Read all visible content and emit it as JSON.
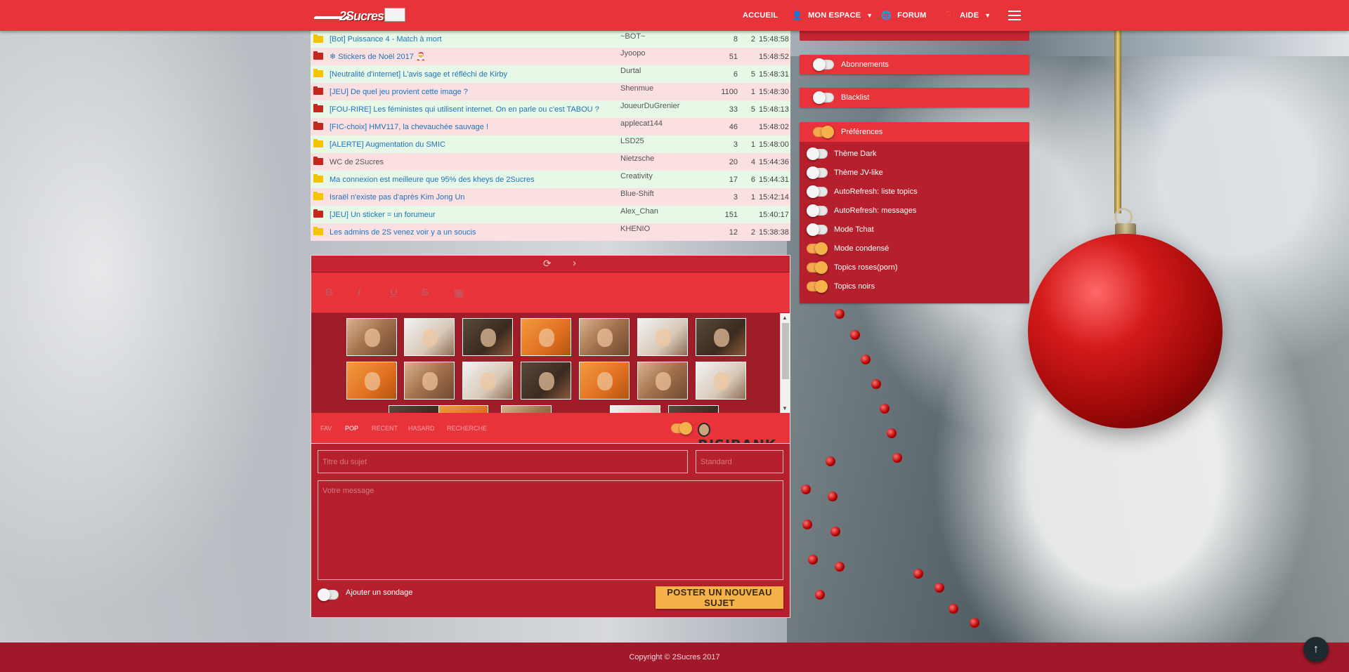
{
  "nav": {
    "logo_text": "2Sucres",
    "accueil": "ACCUEIL",
    "mon_espace": "MON ESPACE",
    "forum": "FORUM",
    "aide": "AIDE"
  },
  "topics": [
    {
      "title": "[Bot] Puissance 4 - Match à mort",
      "author": "~BOT~",
      "count": "8",
      "new": "2",
      "time": "15:48:58",
      "folder": "yellow"
    },
    {
      "title": "❄ Stickers de Noël 2017 🎅",
      "author": "Jyoopo",
      "count": "51",
      "new": "",
      "time": "15:48:52",
      "folder": "red"
    },
    {
      "title": "[Neutralité d'internet] L'avis sage et réfléchi de Kirby",
      "author": "Durtal",
      "count": "6",
      "new": "5",
      "time": "15:48:31",
      "folder": "yellow"
    },
    {
      "title": "[JEU] De quel jeu provient cette image ?",
      "author": "Shenmue",
      "count": "1100",
      "new": "1",
      "time": "15:48:30",
      "folder": "red"
    },
    {
      "title": "[FOU-RIRE] Les féministes qui utilisent internet. On en parle ou c'est TABOU ?",
      "author": "JoueurDuGrenier",
      "count": "33",
      "new": "5",
      "time": "15:48:13",
      "folder": "red"
    },
    {
      "title": "[FIC-choix] HMV117, la chevauchée sauvage !",
      "author": "applecat144",
      "count": "46",
      "new": "",
      "time": "15:48:02",
      "folder": "red"
    },
    {
      "title": "[ALERTE] Augmentation du SMIC",
      "author": "LSD25",
      "count": "3",
      "new": "1",
      "time": "15:48:00",
      "folder": "yellow"
    },
    {
      "title": "WC de 2Sucres",
      "author": "Nietzsche",
      "count": "20",
      "new": "4",
      "time": "15:44:36",
      "folder": "red",
      "grey": true
    },
    {
      "title": "Ma connexion est meilleure que 95% des kheys de 2Sucres",
      "author": "Creativity",
      "count": "17",
      "new": "6",
      "time": "15:44:31",
      "folder": "yellow"
    },
    {
      "title": "Israël n'existe pas d'après Kim Jong Un",
      "author": "Blue-Shift",
      "count": "3",
      "new": "1",
      "time": "15:42:14",
      "folder": "yellow"
    },
    {
      "title": "[JEU] Un sticker = un forumeur",
      "author": "Alex_Chan",
      "count": "151",
      "new": "",
      "time": "15:40:17",
      "folder": "red"
    },
    {
      "title": "Les admins de 2S venez voir y a un soucis",
      "author": "KHENIO",
      "count": "12",
      "new": "2",
      "time": "15:38:38",
      "folder": "yellow"
    }
  ],
  "editor": {
    "toolbar": {
      "bold": "B",
      "italic": "I",
      "underline": "U",
      "strike": "S",
      "image": "▣"
    },
    "tabs": [
      "FAV",
      "POP",
      "RECENT",
      "HASARD",
      "RECHERCHE"
    ],
    "active_tab": "POP",
    "risibank": "RISIBANK",
    "title_placeholder": "Titre du sujet",
    "category_placeholder": "Standard",
    "message_placeholder": "Votre message",
    "poll_label": "Ajouter un sondage",
    "post_button": "POSTER UN NOUVEAU SUJET"
  },
  "panel": {
    "abonnements": "Abonnements",
    "blacklist": "Blacklist",
    "preferences": "Préférences",
    "prefs": [
      {
        "label": "Thème Dark",
        "on": false
      },
      {
        "label": "Thème JV-like",
        "on": false
      },
      {
        "label": "AutoRefresh: liste topics",
        "on": false
      },
      {
        "label": "AutoRefresh: messages",
        "on": false
      },
      {
        "label": "Mode Tchat",
        "on": false
      },
      {
        "label": "Mode condensé",
        "on": true
      },
      {
        "label": "Topics roses(porn)",
        "on": true
      },
      {
        "label": "Topics noirs",
        "on": true
      }
    ]
  },
  "footer": {
    "copyright": "Copyright © 2Sucres 2017"
  },
  "colors": {
    "accent": "#e8333a",
    "dark_accent": "#b5202c",
    "toggle_on": "#f8a94f",
    "link": "#1e73be"
  }
}
